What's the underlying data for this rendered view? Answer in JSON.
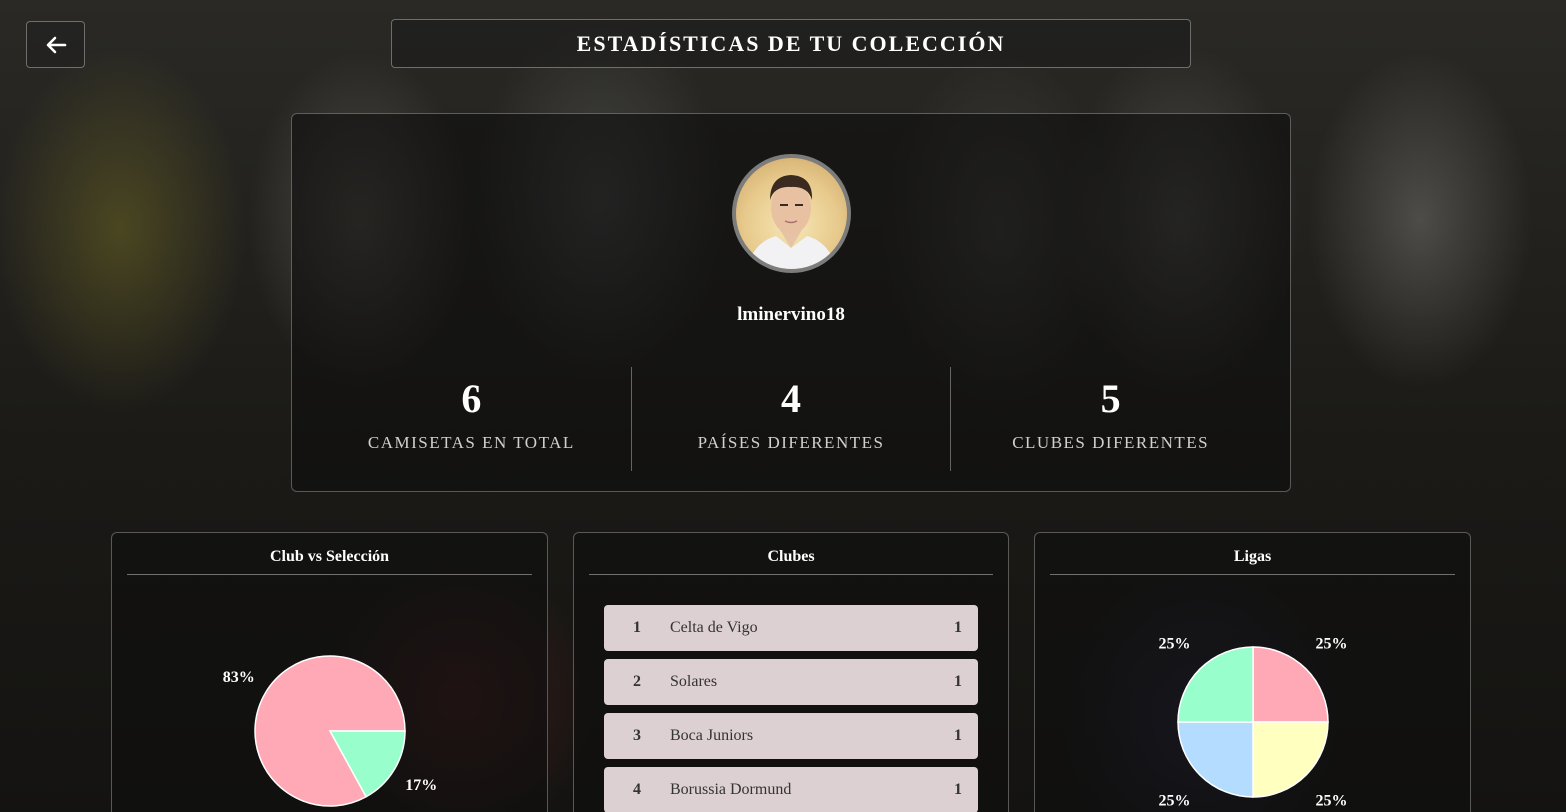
{
  "header": {
    "title": "ESTADÍSTICAS DE TU COLECCIÓN"
  },
  "profile": {
    "username": "lminervino18",
    "stats": [
      {
        "value": "6",
        "label": "CAMISETAS EN TOTAL"
      },
      {
        "value": "4",
        "label": "PAÍSES DIFERENTES"
      },
      {
        "value": "5",
        "label": "CLUBES DIFERENTES"
      }
    ]
  },
  "panels": {
    "club_vs_seleccion": {
      "title": "Club vs Selección"
    },
    "clubes": {
      "title": "Clubes",
      "items": [
        {
          "rank": "1",
          "name": "Celta de Vigo",
          "count": "1"
        },
        {
          "rank": "2",
          "name": "Solares",
          "count": "1"
        },
        {
          "rank": "3",
          "name": "Boca Juniors",
          "count": "1"
        },
        {
          "rank": "4",
          "name": "Borussia Dormund",
          "count": "1"
        }
      ]
    },
    "ligas": {
      "title": "Ligas"
    }
  },
  "icons": {
    "back": "arrow-left-icon"
  },
  "colors": {
    "pink": "#ffa8b6",
    "mint": "#98ffcc",
    "yellow": "#ffffc0",
    "blue": "#b4dcff",
    "list_row": "#ddd0d3"
  },
  "chart_data": [
    {
      "type": "pie",
      "title": "Club vs Selección",
      "slices": [
        {
          "value": 83,
          "label": "83%",
          "color": "#ffa8b6"
        },
        {
          "value": 17,
          "label": "17%",
          "color": "#98ffcc"
        }
      ]
    },
    {
      "type": "pie",
      "title": "Ligas",
      "slices": [
        {
          "value": 25,
          "label": "25%",
          "color": "#ffa8b6"
        },
        {
          "value": 25,
          "label": "25%",
          "color": "#ffffc0"
        },
        {
          "value": 25,
          "label": "25%",
          "color": "#b4dcff"
        },
        {
          "value": 25,
          "label": "25%",
          "color": "#98ffcc"
        }
      ]
    }
  ]
}
